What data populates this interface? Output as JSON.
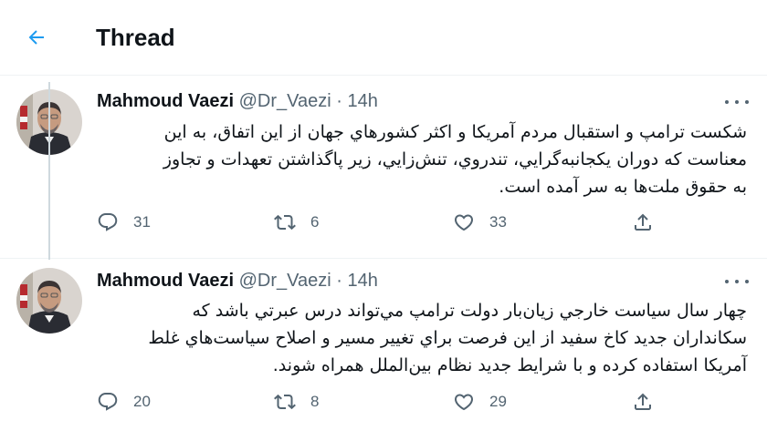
{
  "header": {
    "title": "Thread",
    "back_icon": "arrow-left-icon",
    "accent": "#1d9bf0"
  },
  "tweets": [
    {
      "author_name": "Mahmoud Vaezi",
      "handle": "@Dr_Vaezi",
      "separator": "·",
      "time": "14h",
      "text_lines": [
        "شکست ترامپ و استقبال مردم آمريکا و اکثر کشورهاي جهان از اين اتفاق، به اين",
        "معناست که دوران يکجانبه‌گرايي، تندروي، تنش‌زايي، زير پاگذاشتن تعهدات و تجاوز",
        "به حقوق ملت‌ها به سر آمده است."
      ],
      "replies": "31",
      "retweets": "6",
      "likes": "33"
    },
    {
      "author_name": "Mahmoud Vaezi",
      "handle": "@Dr_Vaezi",
      "separator": "·",
      "time": "14h",
      "text_lines": [
        "چهار سال سياست خارجي زيان‌بار دولت ترامپ مي‌تواند درس عبرتي باشد که",
        "سکانداران جديد کاخ سفيد از اين فرصت براي تغيير مسير و اصلاح سياست‌هاي غلط",
        "آمريکا استفاده کرده و با شرايط جديد نظام بين‌الملل همراه شوند."
      ],
      "replies": "20",
      "retweets": "8",
      "likes": "29"
    }
  ],
  "colors": {
    "text": "#0f1419",
    "secondary": "#536471",
    "divider": "#eff3f4",
    "thread_line": "#cfd9de"
  }
}
